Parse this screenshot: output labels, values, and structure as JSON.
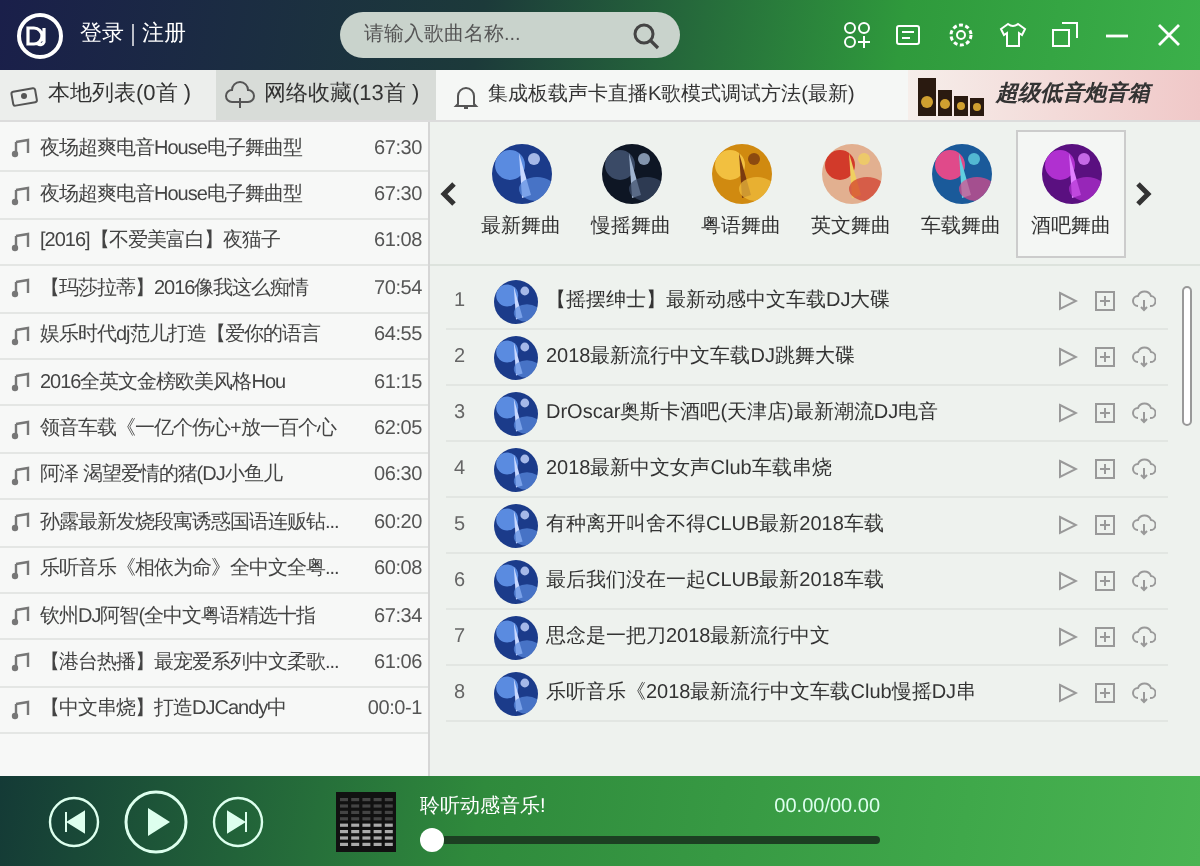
{
  "header": {
    "account": [
      "登录",
      "注册"
    ],
    "search": {
      "placeholder": "请输入歌曲名称..."
    }
  },
  "tabs": [
    {
      "label": "本地列表(0首 )",
      "selected": false
    },
    {
      "label": "网络收藏(13首 )",
      "selected": true
    }
  ],
  "notice": "集成板载声卡直播K歌模式调试方法(最新)",
  "banner": {
    "text": "超级低音炮音箱"
  },
  "playlist": [
    {
      "title": "夜场超爽电音House电子舞曲型",
      "duration": "67:30"
    },
    {
      "title": "夜场超爽电音House电子舞曲型",
      "duration": "67:30"
    },
    {
      "title": "[2016]【不爱美富白】夜猫子",
      "duration": "61:08"
    },
    {
      "title": "【玛莎拉蒂】2016像我这么痴情",
      "duration": "70:54"
    },
    {
      "title": "娱乐时代dj范儿打造【爱你的语言",
      "duration": "64:55"
    },
    {
      "title": "2016全英文金榜欧美风格Hou",
      "duration": "61:15"
    },
    {
      "title": "领音车载《一亿个伤心+放一百个心",
      "duration": "62:05"
    },
    {
      "title": "阿泽  渴望爱情的猪(DJ小鱼儿",
      "duration": "06:30"
    },
    {
      "title": "孙露最新发烧段寓诱惑国语连贩钻...",
      "duration": "60:20"
    },
    {
      "title": "乐听音乐《相依为命》全中文全粤...",
      "duration": "60:08"
    },
    {
      "title": "钦州DJ阿智(全中文粤语精选十指",
      "duration": "67:34"
    },
    {
      "title": "【港台热播】最宠爱系列中文柔歌...",
      "duration": "61:06"
    },
    {
      "title": "【中文串烧】打造DJCandy中",
      "duration": "00:0-1"
    }
  ],
  "categories": [
    {
      "label": "最新舞曲",
      "selected": false
    },
    {
      "label": "慢摇舞曲",
      "selected": false
    },
    {
      "label": "粤语舞曲",
      "selected": false
    },
    {
      "label": "英文舞曲",
      "selected": false
    },
    {
      "label": "车载舞曲",
      "selected": false
    },
    {
      "label": "酒吧舞曲",
      "selected": true
    }
  ],
  "songs": [
    {
      "index": "1",
      "title": "【摇摆绅士】最新动感中文车载DJ大碟"
    },
    {
      "index": "2",
      "title": "2018最新流行中文车载DJ跳舞大碟"
    },
    {
      "index": "3",
      "title": "DrOscar奥斯卡酒吧(天津店)最新潮流DJ电音"
    },
    {
      "index": "4",
      "title": "2018最新中文女声Club车载串烧"
    },
    {
      "index": "5",
      "title": "有种离开叫舍不得CLUB最新2018车载"
    },
    {
      "index": "6",
      "title": "最后我们没在一起CLUB最新2018车载"
    },
    {
      "index": "7",
      "title": "思念是一把刀2018最新流行中文"
    },
    {
      "index": "8",
      "title": "乐听音乐《2018最新流行中文车载Club慢摇DJ串"
    }
  ],
  "player": {
    "now_playing": "聆听动感音乐!",
    "time": "00.00/00.00",
    "level": 0
  }
}
